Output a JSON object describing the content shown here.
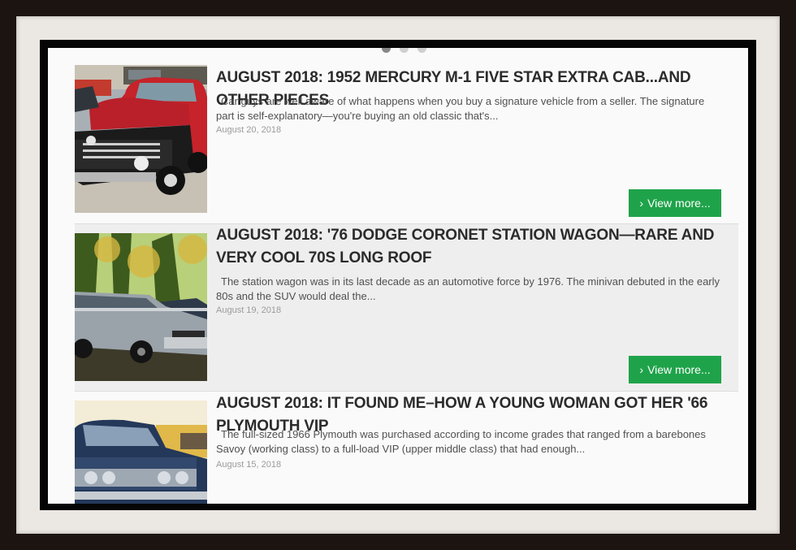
{
  "posts": [
    {
      "title": "AUGUST 2018: 1952 MERCURY M-1 FIVE STAR EXTRA CAB...AND OTHER PIECES",
      "excerpt": "Car guys are well aware of what happens when you buy a signature vehicle from a seller.   The signature part is self-explanatory—you're buying an old classic that's...",
      "date": "August 20, 2018",
      "button_label": "View more...",
      "button_icon": "chevron-right-icon"
    },
    {
      "title": "AUGUST 2018: '76 DODGE CORONET STATION WAGON—RARE AND VERY COOL 70S LONG ROOF",
      "excerpt": "The station wagon was in its last decade as an automotive force by 1976.   The minivan debuted in the early 80s and the SUV would deal the...",
      "date": "August 19, 2018",
      "button_label": "View more...",
      "button_icon": "chevron-right-icon"
    },
    {
      "title": "AUGUST 2018: IT FOUND ME–HOW A YOUNG WOMAN GOT HER '66 PLYMOUTH VIP",
      "excerpt": "The full-sized 1966 Plymouth was purchased according to income grades that ranged from a barebones Savoy (working class) to a full-load VIP (upper middle class) that had enough...",
      "date": "August 15, 2018"
    }
  ],
  "slider": {
    "dot_count": 3,
    "active_index": 0
  },
  "colors": {
    "button": "#1fa34a",
    "title": "#2b2b2b",
    "alt_row": "#eeeeee"
  }
}
